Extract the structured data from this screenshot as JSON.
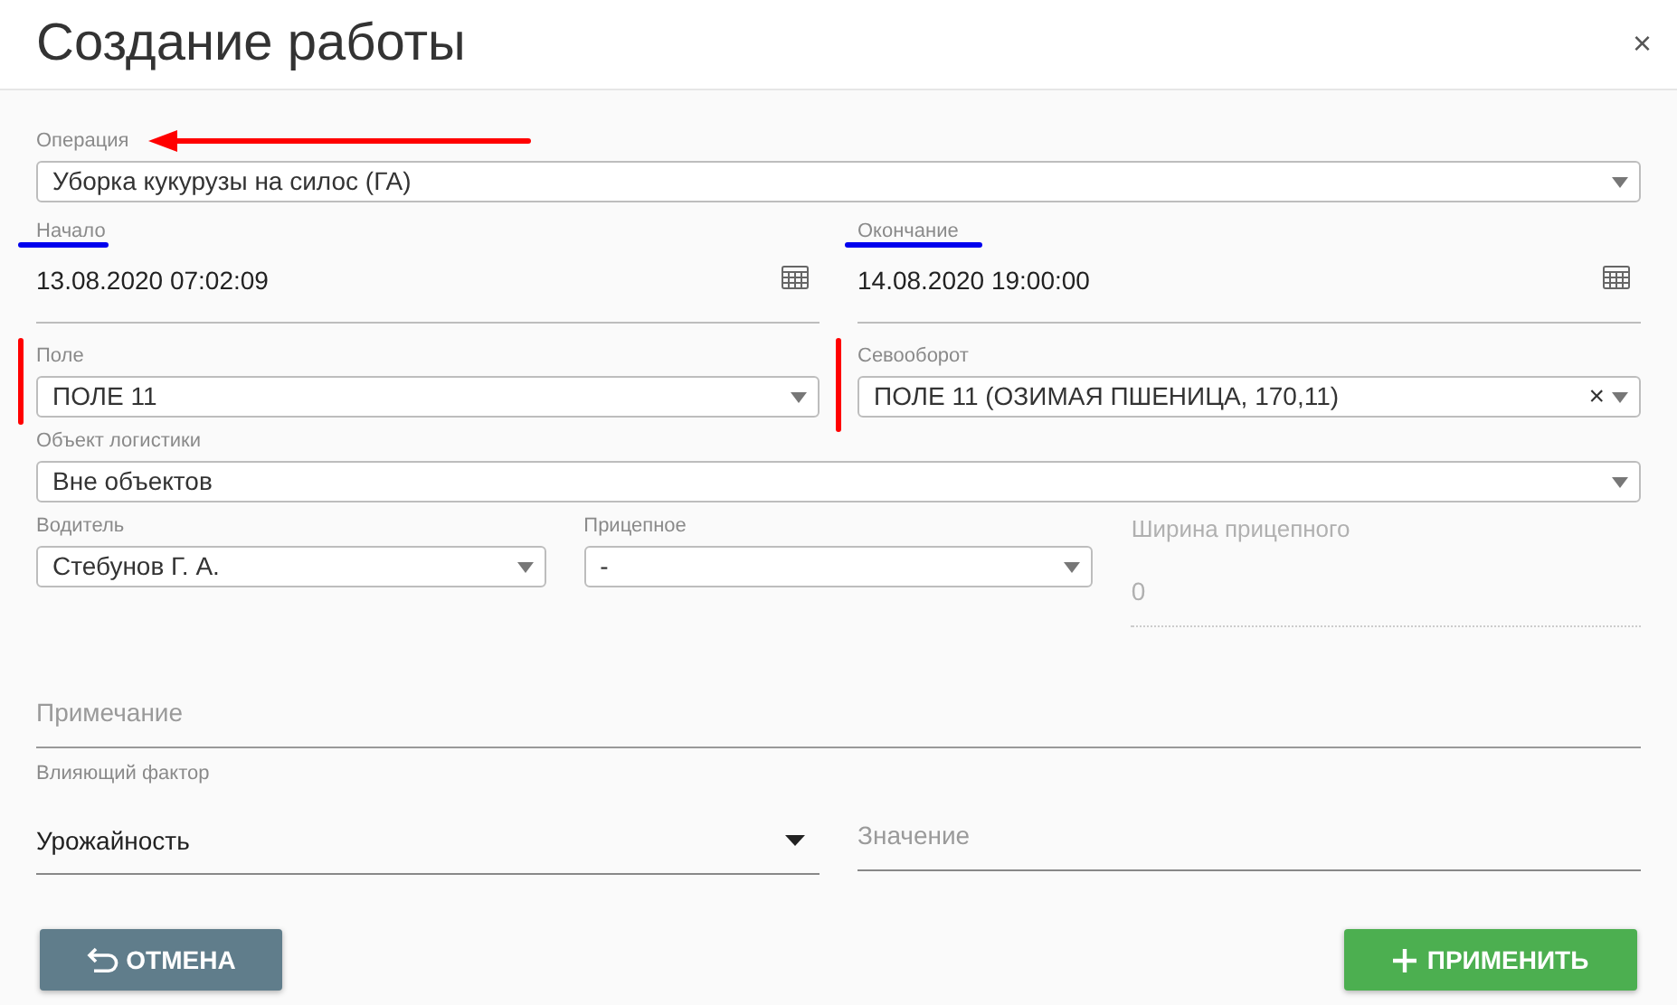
{
  "dialog": {
    "title": "Создание работы",
    "close": "×"
  },
  "operation": {
    "label": "Операция",
    "value": "Уборка кукурузы на силос (ГА)"
  },
  "start": {
    "label": "Начало",
    "value": "13.08.2020 07:02:09"
  },
  "end": {
    "label": "Окончание",
    "value": "14.08.2020 19:00:00"
  },
  "field": {
    "label": "Поле",
    "value": "ПОЛЕ 11"
  },
  "crop_rotation": {
    "label": "Севооборот",
    "value": "ПОЛЕ 11 (ОЗИМАЯ ПШЕНИЦА, 170,11)",
    "clearable": true,
    "clear": "×"
  },
  "logistics_object": {
    "label": "Объект логистики",
    "value": "Вне объектов"
  },
  "driver": {
    "label": "Водитель",
    "value": "Стебунов Г. А."
  },
  "trailer": {
    "label": "Прицепное",
    "value": "-"
  },
  "trailer_width": {
    "label": "Ширина прицепного",
    "value": "0",
    "disabled": true
  },
  "note": {
    "placeholder": "Примечание"
  },
  "factor": {
    "label": "Влияющий фактор",
    "value": "Урожайность"
  },
  "factor_value": {
    "placeholder": "Значение"
  },
  "buttons": [
    {
      "kind": "cancel",
      "label": "ОТМЕНА"
    },
    {
      "kind": "apply",
      "label": "ПРИМЕНИТЬ"
    }
  ]
}
